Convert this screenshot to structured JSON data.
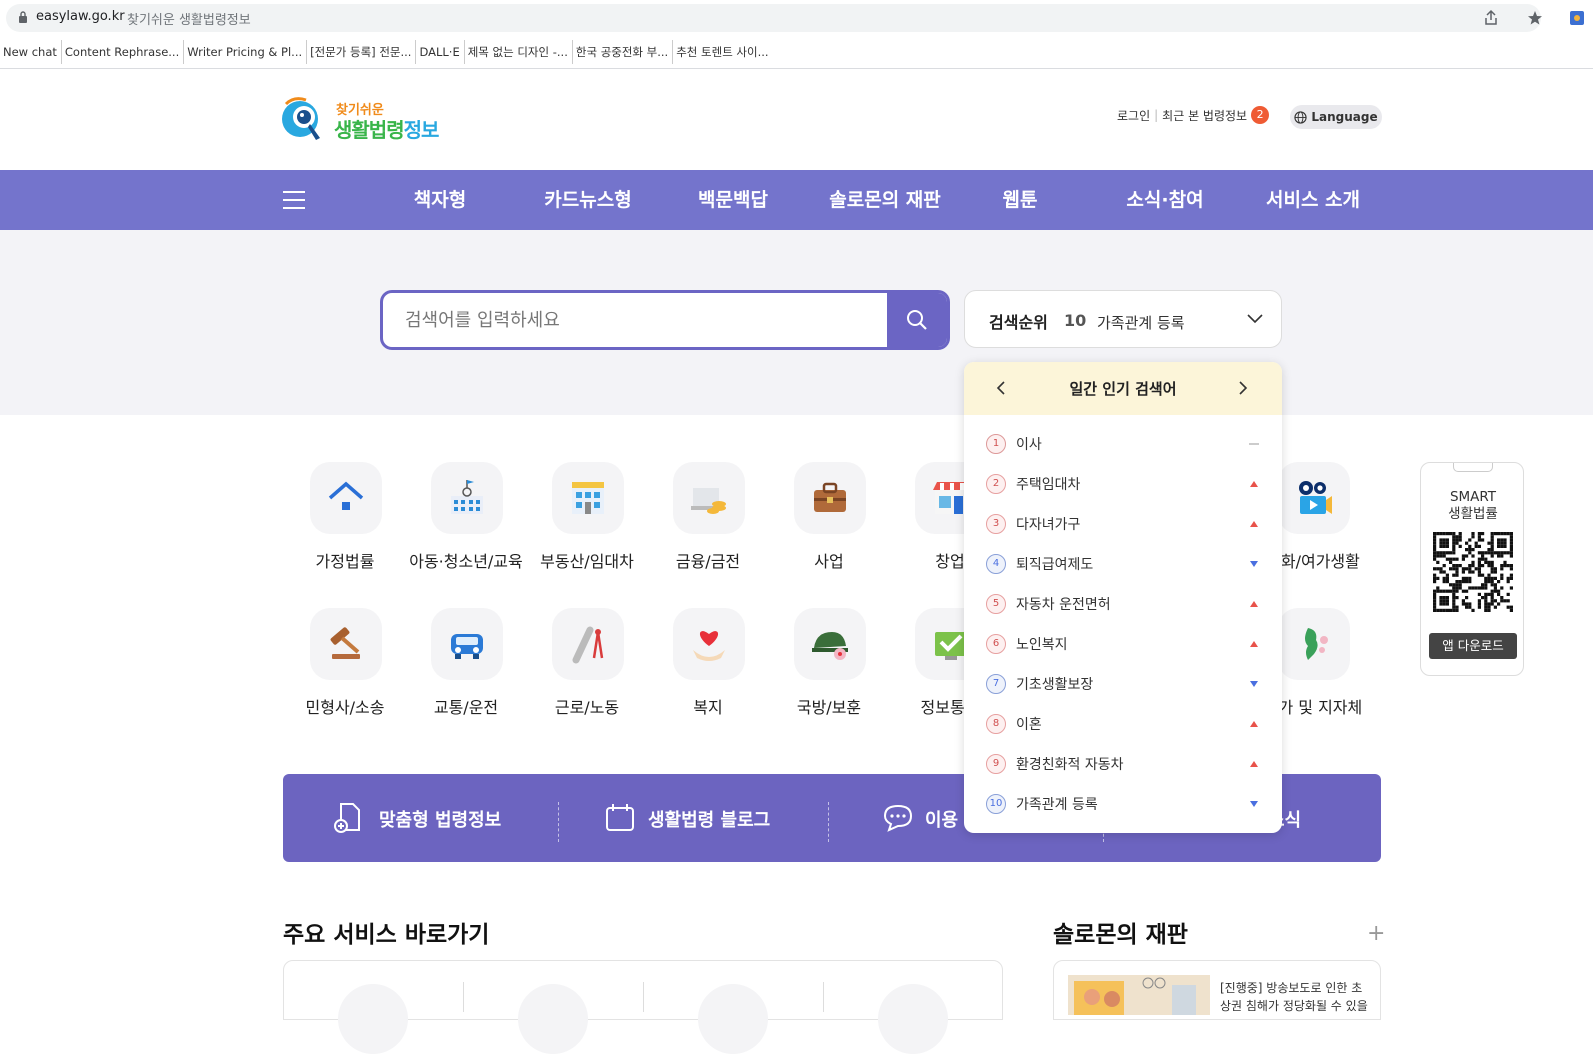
{
  "browser": {
    "url_host": "easylaw.go.kr",
    "page_title": "찾기쉬운 생활법령정보",
    "bookmarks": [
      "New chat",
      "Content Rephrase...",
      "Writer Pricing & Pl...",
      "[전문가 등록] 전문...",
      "DALL·E",
      "제목 없는 디자인 -...",
      "한국 공중전화 부...",
      "추천 토렌트 사이..."
    ]
  },
  "header": {
    "logo_sub": "찾기쉬운",
    "logo_main_a": "생활법령",
    "logo_main_b": "정보",
    "login": "로그인",
    "recent": "최근 본 법령정보",
    "recent_count": "2",
    "language": "Language"
  },
  "nav": {
    "items": [
      "책자형",
      "카드뉴스형",
      "백문백답",
      "솔로몬의 재판",
      "웹툰",
      "소식·참여",
      "서비스 소개"
    ]
  },
  "search": {
    "placeholder": "검색어를 입력하세요",
    "rank_title": "검색순위",
    "rank_current_num": "10",
    "rank_current_term": "가족관계 등록"
  },
  "ranking": {
    "title": "일간 인기 검색어",
    "items": [
      {
        "num": "1",
        "term": "이사",
        "trend": "same"
      },
      {
        "num": "2",
        "term": "주택임대차",
        "trend": "up"
      },
      {
        "num": "3",
        "term": "다자녀가구",
        "trend": "up"
      },
      {
        "num": "4",
        "term": "퇴직급여제도",
        "trend": "down"
      },
      {
        "num": "5",
        "term": "자동차 운전면허",
        "trend": "up"
      },
      {
        "num": "6",
        "term": "노인복지",
        "trend": "up"
      },
      {
        "num": "7",
        "term": "기초생활보장",
        "trend": "down"
      },
      {
        "num": "8",
        "term": "이혼",
        "trend": "up"
      },
      {
        "num": "9",
        "term": "환경친화적 자동차",
        "trend": "up"
      },
      {
        "num": "10",
        "term": "가족관계 등록",
        "trend": "down"
      }
    ]
  },
  "categories": {
    "row1": [
      "가정법률",
      "아동·청소년/교육",
      "부동산/임대차",
      "금융/금전",
      "사업",
      "창업",
      "",
      "",
      "문화/여가생활"
    ],
    "row2": [
      "민형사/소송",
      "교통/운전",
      "근로/노동",
      "복지",
      "국방/보훈",
      "정보통신",
      "",
      "",
      "국가 및 지자체"
    ]
  },
  "smart_app": {
    "title_line1": "SMART",
    "title_line2": "생활법률",
    "download": "앱 다운로드"
  },
  "quick_links": [
    "맞춤형 법령정보",
    "생활법령 블로그",
    "이용",
    "소식"
  ],
  "sections": {
    "services_title": "주요 서비스 바로가기",
    "solomon_title": "솔로몬의 재판",
    "solomon_more": "+",
    "solomon_item": "[진행중] 방송보도로 인한 초상권 침해가 정당화될 수 있을"
  },
  "colors": {
    "brand_purple": "#7474cc",
    "search_purple": "#6b65c4",
    "up_red": "#e8524a",
    "down_blue": "#4a6fe0",
    "badge_orange": "#ef5b34"
  }
}
